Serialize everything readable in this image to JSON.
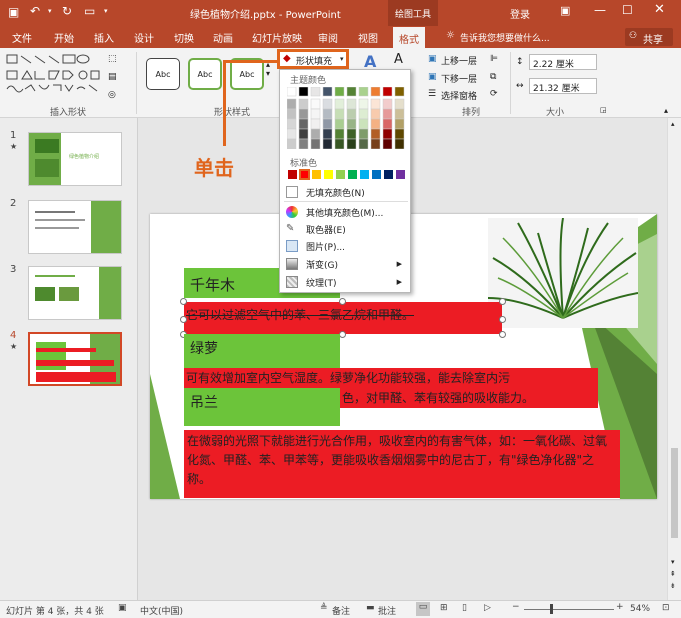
{
  "title_bar": {
    "doc_title": "绿色植物介绍.pptx - PowerPoint",
    "tool_tab": "绘图工具",
    "login": "登录"
  },
  "tabs": [
    "文件",
    "开始",
    "插入",
    "设计",
    "切换",
    "动画",
    "幻灯片放映",
    "审阅",
    "视图",
    "格式"
  ],
  "active_tab": "格式",
  "tell_me": "告诉我您想要做什么...",
  "share": "共享",
  "ribbon": {
    "group_insert_shapes": "插入形状",
    "group_shape_styles": "形状样式",
    "group_arrange": "排列",
    "group_size": "大小",
    "style_samples": [
      "Abc",
      "Abc",
      "Abc"
    ],
    "shape_fill": "形状填充",
    "bring_forward": "上移一层",
    "send_backward": "下移一层",
    "selection_pane": "选择窗格",
    "height": "2.22 厘米",
    "width": "21.32 厘米"
  },
  "annotation": {
    "text": "单击",
    "color": "#e0651d"
  },
  "dropdown": {
    "theme_colors_label": "主题颜色",
    "standard_colors_label": "标准色",
    "no_fill": "无填充颜色(N)",
    "more_colors": "其他填充颜色(M)...",
    "eyedropper": "取色器(E)",
    "picture": "图片(P)...",
    "gradient": "渐变(G)",
    "texture": "纹理(T)",
    "theme_top": [
      "#ffffff",
      "#000000",
      "#e7e6e6",
      "#44546a",
      "#70ad47",
      "#548235",
      "#a9d18e",
      "#ed7d31",
      "#c00000",
      "#7f6000"
    ],
    "standard": [
      "#c00000",
      "#ff0000",
      "#ffc000",
      "#ffff00",
      "#92d050",
      "#00b050",
      "#00b0f0",
      "#0070c0",
      "#002060",
      "#7030a0"
    ]
  },
  "slides": {
    "numbers": [
      "1",
      "2",
      "3",
      "4"
    ],
    "thumb1_title": "绿色植物介绍"
  },
  "slide": {
    "plant1": "千年木",
    "text1": "它可以过滤空气中的苯、三氯乙烷和甲醛。",
    "plant2": "绿萝",
    "text2a": "可有效增加室内空气湿度。绿萝净化功能较强，能去除室内污",
    "text2b": "色，对甲醛、苯有较强的吸收能力。",
    "plant3": "吊兰",
    "text3": "在微弱的光照下就能进行光合作用，吸收室内的有害气体，如：一氧化碳、过氧化氮、甲醛、苯、甲苯等，更能吸收香烟烟雾中的尼古丁，有\"绿色净化器\"之称。"
  },
  "status": {
    "slide_info": "幻灯片 第 4 张，共 4 张",
    "language": "中文(中国)",
    "notes": "备注",
    "comments": "批注",
    "zoom": "54%"
  }
}
